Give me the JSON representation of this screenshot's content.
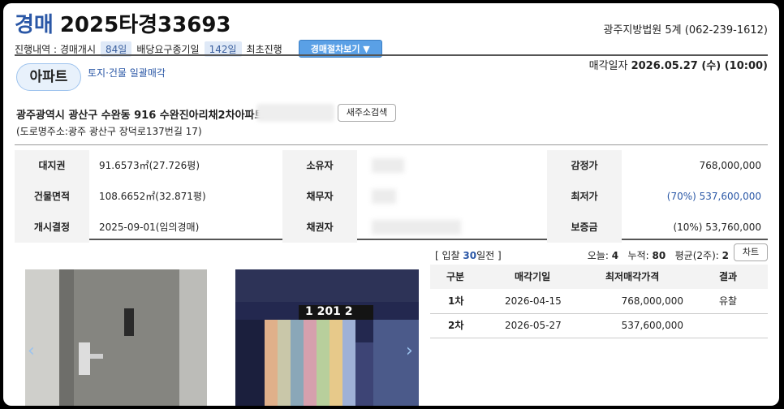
{
  "header": {
    "kind": "경매",
    "case_no": "2025타경33693",
    "court": "광주지방법원 5계 (062-239-1612)",
    "progress_label": "진행내역 : 경매개시",
    "days_since_start": "84일",
    "dividend_label": "배당요구종기일",
    "days_dividend": "142일",
    "first_label": "최초진행",
    "procedure_button": "경매절차보기 ▼"
  },
  "property": {
    "type_badge": "아파트",
    "bulk_sale": "토지·건물 일괄매각",
    "sale_date_label": "매각일자",
    "sale_date": "2026.05.27 (수) (10:00)",
    "address": "광주광역시 광산구 수완동 916 수완진아리채2차아파트",
    "search_button": "새주소검색",
    "road_address": "(도로명주소:광주 광산구 장덕로137번길 17)"
  },
  "info_table": {
    "land_right_label": "대지권",
    "land_right": "91.6573㎡(27.726평)",
    "owner_label": "소유자",
    "appraisal_label": "감정가",
    "appraisal": "768,000,000",
    "building_area_label": "건물면적",
    "building_area": "108.6652㎡(32.871평)",
    "debtor_label": "채무자",
    "min_price_label": "최저가",
    "min_price": "(70%) 537,600,000",
    "decision_label": "개시결정",
    "decision": "2025-09-01(임의경매)",
    "creditor_label": "채권자",
    "deposit_label": "보증금",
    "deposit": "(10%) 53,760,000"
  },
  "photos": {
    "sign_text": "1 201 2"
  },
  "stats": {
    "prefix": "[ 입찰",
    "days": "30",
    "suffix": "일전 ]",
    "views_today_label": "오늘:",
    "views_today": "4",
    "views_total_label": "누적:",
    "views_total": "80",
    "avg_label": "평균(2주):",
    "avg": "2",
    "chart_button": "차트"
  },
  "history": {
    "headers": [
      "구분",
      "매각기일",
      "최저매각가격",
      "결과"
    ],
    "rows": [
      {
        "round": "1차",
        "date": "2026-04-15",
        "price": "768,000,000",
        "result": "유찰"
      },
      {
        "round": "2차",
        "date": "2026-05-27",
        "price": "537,600,000",
        "result": ""
      }
    ]
  },
  "colors": {
    "accent": "#2a57a6",
    "button": "#5aa0e6"
  }
}
